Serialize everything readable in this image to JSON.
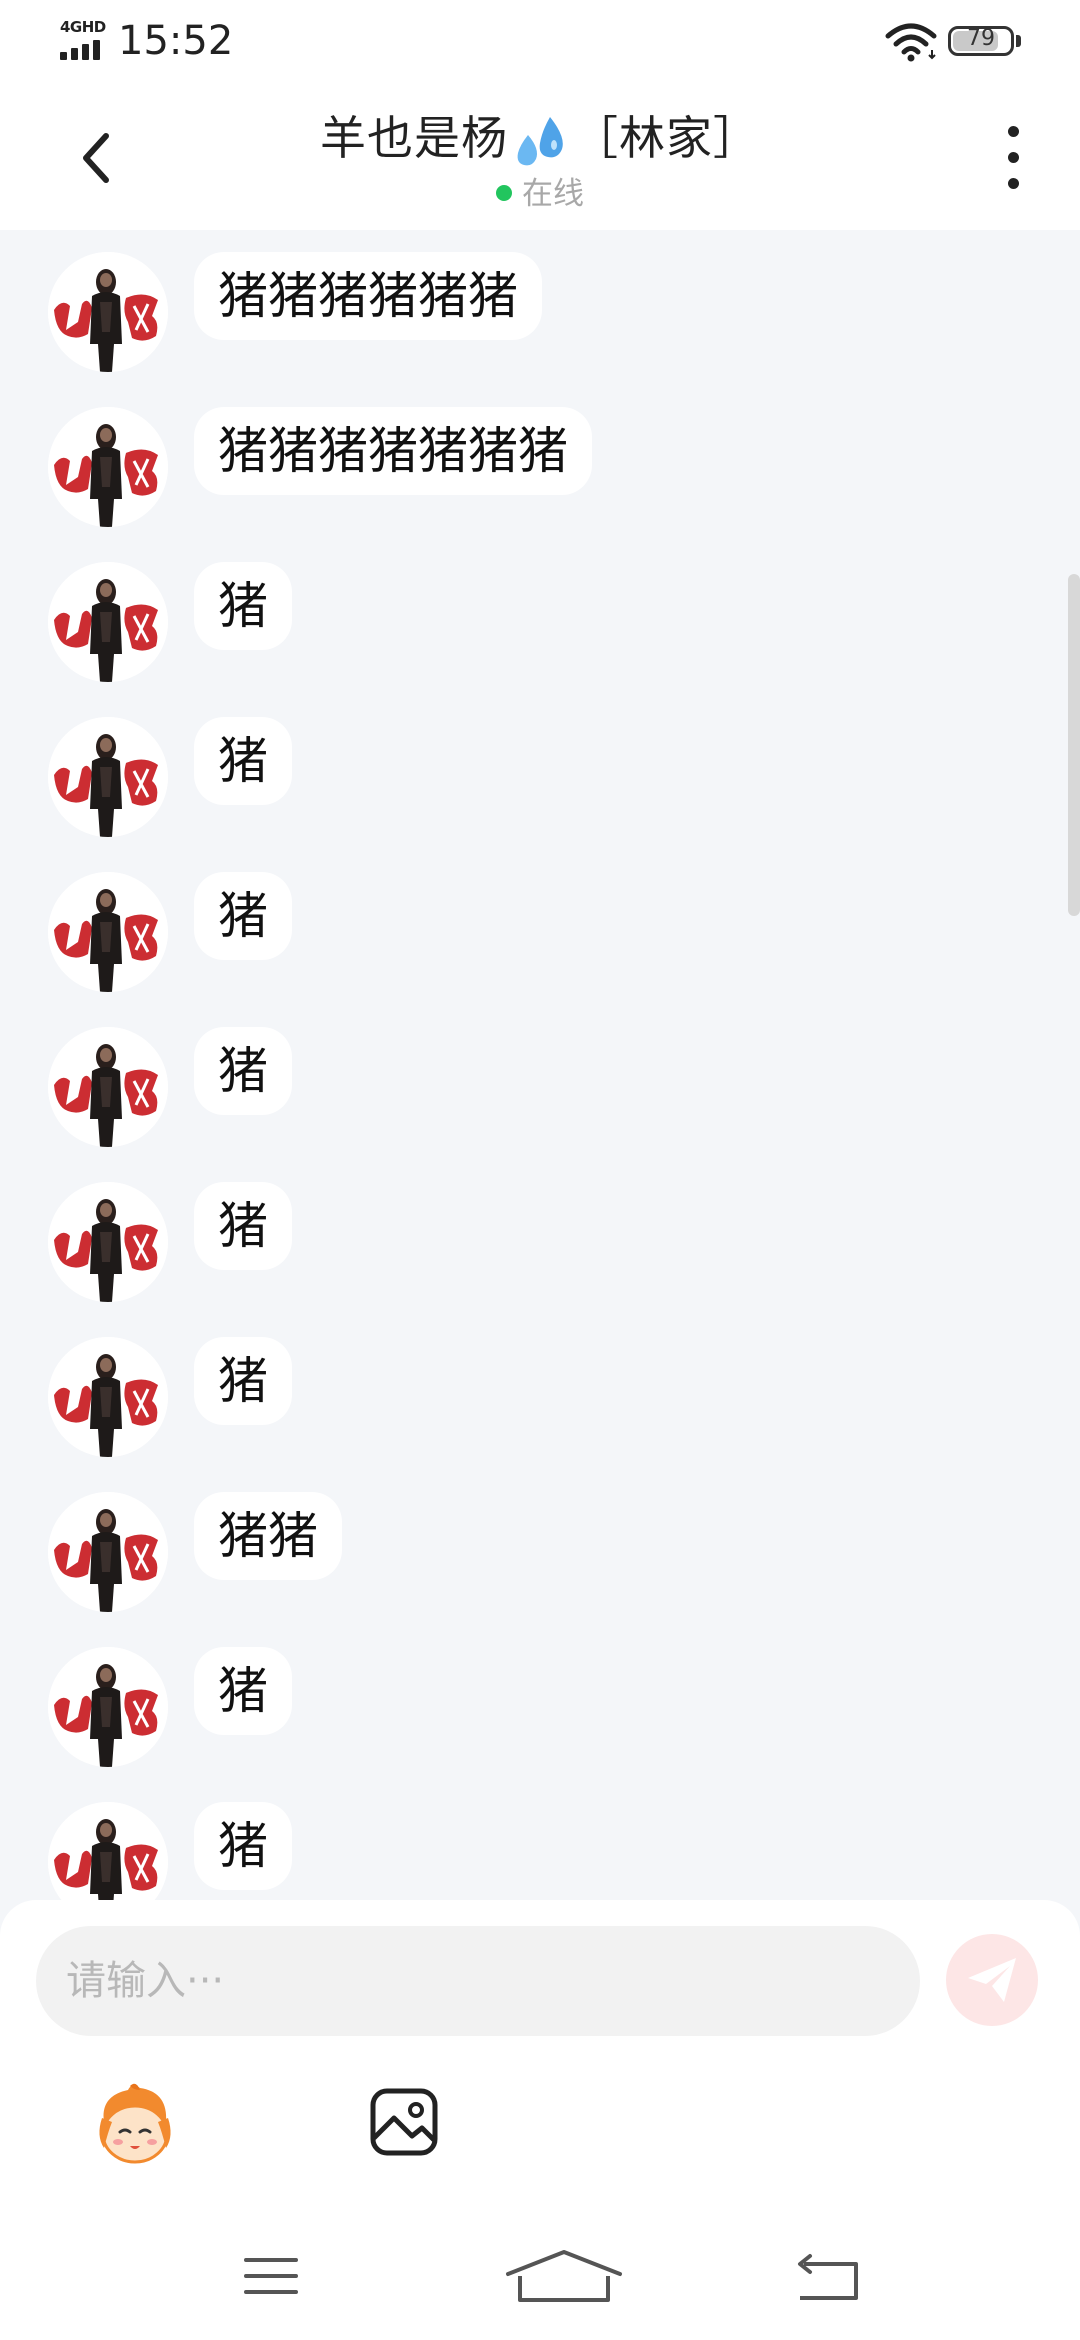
{
  "status_bar": {
    "network": "4GHD",
    "time": "15:52",
    "battery_level": "79",
    "icons": [
      "signal-icon",
      "wifi-icon",
      "battery-icon"
    ]
  },
  "header": {
    "title": "羊也是杨",
    "title_tag": "［林家］",
    "title_emoji": "sweat-droplets-icon",
    "status_text": "在线",
    "status_color": "#22c55e",
    "icons": [
      "back-arrow-icon",
      "more-vertical-icon"
    ]
  },
  "messages": [
    {
      "text": "猪猪猪猪猪猪"
    },
    {
      "text": "猪猪猪猪猪猪猪"
    },
    {
      "text": "猪"
    },
    {
      "text": "猪"
    },
    {
      "text": "猪"
    },
    {
      "text": "猪"
    },
    {
      "text": "猪"
    },
    {
      "text": "猪"
    },
    {
      "text": "猪猪"
    },
    {
      "text": "猪"
    },
    {
      "text": "猪"
    }
  ],
  "composer": {
    "placeholder": "请输入···",
    "value": "",
    "send_icon": "paper-plane-icon",
    "tools": [
      "emoji-sticker-icon",
      "image-icon"
    ]
  },
  "nav_bar": {
    "icons": [
      "menu-icon",
      "home-icon",
      "back-icon"
    ]
  },
  "colors": {
    "background": "#f4f6f9",
    "bubble": "#ffffff",
    "send_button": "#fde6e6",
    "accent": "#ef4444"
  }
}
